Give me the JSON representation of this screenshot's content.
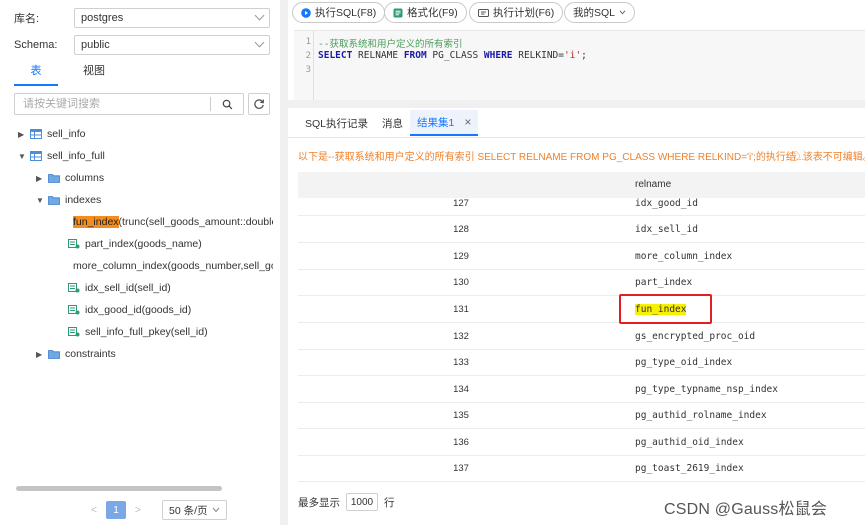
{
  "left": {
    "db": {
      "label": "库名:",
      "value": "postgres"
    },
    "schema": {
      "label": "Schema:",
      "value": "public"
    },
    "tabs": [
      "表",
      "视图"
    ],
    "search": {
      "placeholder": "请按关键词搜索"
    },
    "tree": [
      {
        "label": "sell_info",
        "icon": "table-icon",
        "arrow": "▶"
      },
      {
        "label": "sell_info_full",
        "icon": "table-icon",
        "arrow": "▼"
      },
      {
        "label": "columns",
        "icon": "folder-icon",
        "arrow": "▶"
      },
      {
        "label": "indexes",
        "icon": "folder-icon",
        "arrow": "▼"
      },
      {
        "label_hl": "fun_index",
        "label_rest": "(trunc(sell_goods_amount::double",
        "icon": "index-icon"
      },
      {
        "label": "part_index(goods_name)",
        "icon": "index-icon"
      },
      {
        "label": "more_column_index(goods_number,sell_goo",
        "icon": "index-icon"
      },
      {
        "label": "idx_sell_id(sell_id)",
        "icon": "index-icon"
      },
      {
        "label": "idx_good_id(goods_id)",
        "icon": "index-icon"
      },
      {
        "label": "sell_info_full_pkey(sell_id)",
        "icon": "index-icon"
      },
      {
        "label": "constraints",
        "icon": "folder-icon",
        "arrow": "▶"
      }
    ],
    "pager": {
      "page": "1",
      "size": "50 条/页"
    }
  },
  "toolbar": {
    "run": "执行SQL(F8)",
    "format": "格式化(F9)",
    "plan": "执行计划(F6)",
    "mysql": "我的SQL"
  },
  "editor": {
    "line_numbers": [
      "1",
      "2",
      "3"
    ],
    "comment": "--获取系统和用户定义的所有索引",
    "kw1": "SELECT",
    "t1": " RELNAME ",
    "kw2": "FROM",
    "t2": " PG_CLASS ",
    "kw3": "WHERE",
    "t3": " RELKIND=",
    "str": "'i'",
    "t4": ";"
  },
  "result_tabs": {
    "history": "SQL执行记录",
    "messages": "消息",
    "result": "结果集1",
    "close": "×"
  },
  "notice": {
    "text": "以下是--获取系统和用户定义的所有索引 SELECT RELNAME FROM PG_CLASS WHERE RELKIND='i';的执行结...",
    "warn": "ⓘ 该表不可编辑。"
  },
  "grid": {
    "header": "relname",
    "rows": [
      {
        "num": "127",
        "name": "idx_good_id"
      },
      {
        "num": "128",
        "name": "idx_sell_id"
      },
      {
        "num": "129",
        "name": "more_column_index"
      },
      {
        "num": "130",
        "name": "part_index"
      },
      {
        "num": "131",
        "name": "fun_index"
      },
      {
        "num": "132",
        "name": "gs_encrypted_proc_oid"
      },
      {
        "num": "133",
        "name": "pg_type_oid_index"
      },
      {
        "num": "134",
        "name": "pg_type_typname_nsp_index"
      },
      {
        "num": "135",
        "name": "pg_authid_rolname_index"
      },
      {
        "num": "136",
        "name": "pg_authid_oid_index"
      },
      {
        "num": "137",
        "name": "pg_toast_2619_index"
      }
    ]
  },
  "footer": {
    "prefix": "最多显示",
    "value": "1000",
    "suffix": "行"
  },
  "watermark": "CSDN @Gauss松鼠会"
}
